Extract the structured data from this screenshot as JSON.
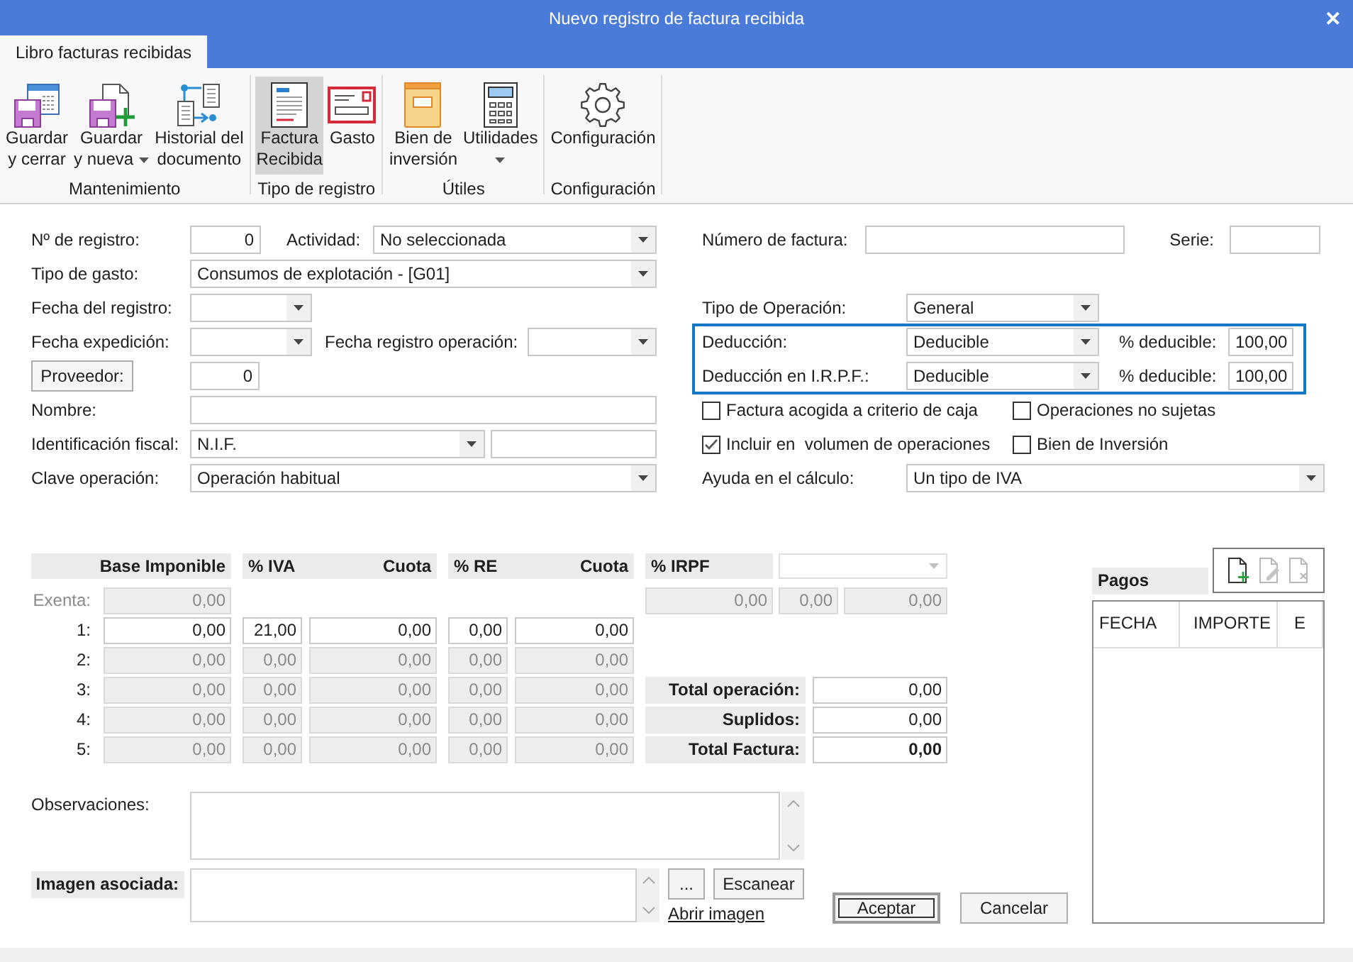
{
  "window": {
    "title": "Nuevo registro de factura recibida",
    "close": "✕"
  },
  "tabs": [
    {
      "label": "Libro facturas recibidas",
      "selected": true
    }
  ],
  "ribbon": [
    {
      "label": "Mantenimiento",
      "buttons": [
        {
          "kind": "saveclose",
          "lines": [
            "Guardar",
            "y cerrar"
          ],
          "selected": false,
          "dropdown": false
        },
        {
          "kind": "savenew",
          "lines": [
            "Guardar",
            "y nueva"
          ],
          "selected": false,
          "dropdown": true
        },
        {
          "kind": "history",
          "lines": [
            "Historial del",
            "documento"
          ],
          "selected": false,
          "dropdown": false
        }
      ]
    },
    {
      "label": "Tipo de registro",
      "buttons": [
        {
          "kind": "invoice",
          "lines": [
            "Factura",
            "Recibida"
          ],
          "selected": true,
          "dropdown": false
        },
        {
          "kind": "expense",
          "lines": [
            "Gasto"
          ],
          "selected": false,
          "dropdown": false
        }
      ]
    },
    {
      "label": "Útiles",
      "buttons": [
        {
          "kind": "asset",
          "lines": [
            "Bien de",
            "inversión"
          ],
          "selected": false,
          "dropdown": false
        },
        {
          "kind": "utilities",
          "lines": [
            "Utilidades"
          ],
          "selected": false,
          "dropdown": true
        }
      ]
    },
    {
      "label": "Configuración",
      "buttons": [
        {
          "kind": "settings",
          "lines": [
            "Configuración"
          ],
          "selected": false,
          "dropdown": false
        }
      ]
    }
  ],
  "form": {
    "registro": {
      "label": "Nº de registro:",
      "value": "0"
    },
    "actividad": {
      "label": "Actividad:",
      "value": "No seleccionada"
    },
    "tipo_gasto": {
      "label": "Tipo de gasto:",
      "value": "Consumos de explotación - [G01]"
    },
    "fecha_registro": {
      "label": "Fecha del registro:"
    },
    "fecha_expedicion": {
      "label": "Fecha expedición:"
    },
    "fecha_registro_operacion": {
      "label": "Fecha registro operación:"
    },
    "proveedor": {
      "button": "Proveedor:",
      "value": "0"
    },
    "nombre": {
      "label": "Nombre:"
    },
    "identificacion_fiscal": {
      "label": "Identificación fiscal:",
      "value": "N.I.F."
    },
    "clave_operacion": {
      "label": "Clave operación:",
      "value": "Operación habitual"
    },
    "numero_factura": {
      "label": "Número de factura:"
    },
    "serie": {
      "label": "Serie:"
    },
    "tipo_operacion": {
      "label": "Tipo de Operación:",
      "value": "General"
    },
    "deducciones": [
      {
        "label": "Deducción:",
        "value": "Deducible",
        "percent_label": "% deducible:",
        "percent": "100,00"
      },
      {
        "label": "Deducción en I.R.P.F.:",
        "value": "Deducible",
        "percent_label": "% deducible:",
        "percent": "100,00"
      }
    ],
    "checkboxes": [
      {
        "label": "Factura acogida a criterio de caja",
        "checked": false
      },
      {
        "label": "Operaciones no sujetas",
        "checked": false
      },
      {
        "label": "Incluir en  volumen de operaciones",
        "checked": true
      },
      {
        "label": "Bien de Inversión",
        "checked": false
      }
    ],
    "ayuda": {
      "label": "Ayuda en el cálculo:",
      "value": "Un tipo de IVA"
    }
  },
  "taxes": {
    "columns": [
      "Base Imponible",
      "% IVA",
      "Cuota",
      "% RE",
      "Cuota"
    ],
    "exempt": {
      "label": "Exenta:",
      "value": "0,00",
      "disabled": true
    },
    "rows": [
      {
        "label": "1:",
        "disabled": false,
        "values": [
          "0,00",
          "21,00",
          "0,00",
          "0,00",
          "0,00"
        ]
      },
      {
        "label": "2:",
        "disabled": true,
        "values": [
          "0,00",
          "0,00",
          "0,00",
          "0,00",
          "0,00"
        ]
      },
      {
        "label": "3:",
        "disabled": true,
        "values": [
          "0,00",
          "0,00",
          "0,00",
          "0,00",
          "0,00"
        ]
      },
      {
        "label": "4:",
        "disabled": true,
        "values": [
          "0,00",
          "0,00",
          "0,00",
          "0,00",
          "0,00"
        ]
      },
      {
        "label": "5:",
        "disabled": true,
        "values": [
          "0,00",
          "0,00",
          "0,00",
          "0,00",
          "0,00"
        ]
      }
    ],
    "irpf": {
      "label": "% IRPF",
      "select_disabled": true,
      "disabled": true,
      "values": [
        "0,00",
        "0,00",
        "0,00"
      ]
    },
    "totals": [
      {
        "kind": "subtotal",
        "label": "Total operación:",
        "value": "0,00"
      },
      {
        "kind": "subtotal",
        "label": "Suplidos:",
        "value": "0,00"
      },
      {
        "kind": "total",
        "label": "Total Factura:",
        "value": "0,00"
      }
    ]
  },
  "payments": {
    "title": "Pagos",
    "columns": [
      "FECHA",
      "IMPORTE",
      "E"
    ],
    "tools": [
      {
        "kind": "add",
        "disabled": false
      },
      {
        "kind": "edit",
        "disabled": true
      },
      {
        "kind": "delete",
        "disabled": true
      }
    ]
  },
  "notes": {
    "label": "Observaciones:"
  },
  "image": {
    "label": "Imagen asociada:",
    "browse": "...",
    "scan": "Escanear",
    "open": "Abrir imagen"
  },
  "actions": [
    {
      "label": "Aceptar",
      "default": true
    },
    {
      "label": "Cancelar",
      "default": false
    }
  ]
}
